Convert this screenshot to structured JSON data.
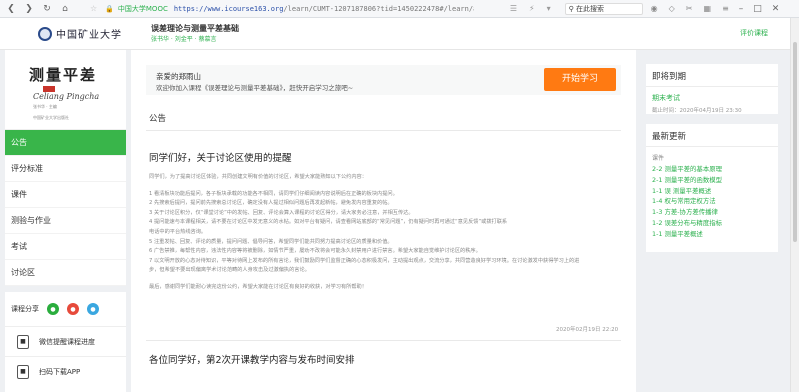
{
  "browser": {
    "secure_label": "🔒",
    "site_label": "中国大学MOOC",
    "url_host": "https://www.icourse163.org",
    "url_path": "/learn/CUMT-1207187806?tid=1450222478#/learn/announce",
    "search_text": "在此搜索"
  },
  "header": {
    "logo_text": "中国矿业大学",
    "course_title": "误差理论与测量平差基础",
    "teachers": "张书华 · 刘金平 · 蔡慕言",
    "review_link": "评价课程"
  },
  "cover": {
    "title": "测量平差",
    "pinyin": "Celiang Pingcha",
    "author": "张书华 · 主编",
    "publisher": "中国矿业大学出版社"
  },
  "sidebar": {
    "items": [
      {
        "label": "公告",
        "active": true
      },
      {
        "label": "评分标准",
        "active": false
      },
      {
        "label": "课件",
        "active": false
      },
      {
        "label": "测验与作业",
        "active": false
      },
      {
        "label": "考试",
        "active": false
      },
      {
        "label": "讨论区",
        "active": false
      }
    ],
    "share_label": "课程分享",
    "promo_wechat": "微信提醒课程进度",
    "promo_app": "扫码下载APP"
  },
  "welcome": {
    "hello": "亲爱的郑雨山",
    "message": "欢迎你加入课程《误差理论与测量平差基础》，赶快开启学习之旅吧~",
    "start_button": "开始学习"
  },
  "announce": {
    "section_title": "公告",
    "post1_title": "同学们好，关于讨论区使用的提醒",
    "post1_lines": [
      "同学们，为了提高讨论区体验，共同创建文明有价值的讨论区，希望大家能熟知以下公约内容：",
      "1 看清板块功能后提问，各子板块承载的功能各不相同，请同学们仔细阅读内容说明后在正确的板块内提问。",
      "2 先搜索后提问，提问前先搜索总讨论区，确定没有人提过相似问题后再发起新帖，避免发内容重复的帖。",
      "3 关于讨论区积分，仅“课堂讨论”中的发帖、回复、评论会算入课程的讨论区得分，请大家务必注意，并相互传达。",
      "4 提问能速与本课程相关，请不要在讨论区中发无意义的水帖。如对平台有疑问，请查看网站底部的“常见问题”，仍有疑问时再可通过“意见反馈”或拨打联系",
      "  电话中的平台热线咨询。",
      "5 注重发帖、回复、评论的质量，提问问题、倡导问答，希望同学们能共同努力提高讨论区的质量和价值。",
      "6 广告禁推，每帮性内容，违法性内容等将被删除，如情节严重，屡劝不改将会可能永久封禁用户进行禁言。希望大家能自觉维护讨论区的秩序。",
      "7 以文明开放的心态对待知识，平等对待网上发布的所有言论，我们鼓励同学们监督正确的心态积极发问，主动提出观点，交流分享，共同营造良好学习环境。在讨论激发中获得学习上的进",
      "  步，但希望不要出现偏离学术讨论范畴的人身攻击及过激偏执的言论。",
      "最后，感谢同学们能耐心读完这份公约，希望大家能在讨论区有良好的收获，对学习有所帮助！"
    ],
    "post1_date": "2020年02月19日 22:20",
    "post2_title": "各位同学好，第2次开课教学内容与发布时间安排"
  },
  "due_panel": {
    "title": "即将到期",
    "item": "期末考试",
    "date": "截止时间：2020年04月19日 23:30"
  },
  "update_panel": {
    "title": "最新更新",
    "section": "课件",
    "links": [
      "2-2 测量平差的基本原理",
      "2-1 测量平差的函数模型",
      "1-1 误 测量平差概述",
      "1-4 权与常用定权方法",
      "1-3 方差-协方差传播律",
      "1-2 误差分布与精度指标",
      "1-1 测量平差概述"
    ]
  },
  "colors": {
    "accent_green": "#39b54a",
    "start_orange": "#ff7a12",
    "link_green": "#2db14f"
  }
}
